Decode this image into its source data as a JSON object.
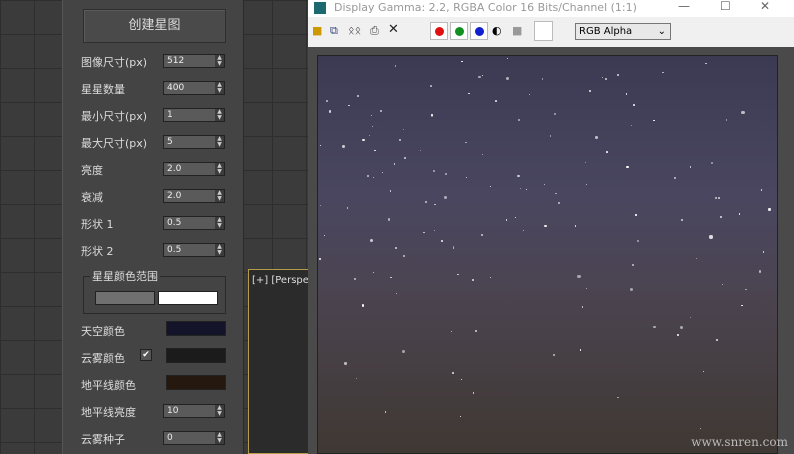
{
  "panel": {
    "create_button": "创建星图",
    "fields": [
      {
        "label": "图像尺寸(px)",
        "value": "512"
      },
      {
        "label": "星星数量",
        "value": "400"
      },
      {
        "label": "最小尺寸(px)",
        "value": "1"
      },
      {
        "label": "最大尺寸(px)",
        "value": "5"
      },
      {
        "label": "亮度",
        "value": "2.0"
      },
      {
        "label": "衰减",
        "value": "2.0"
      },
      {
        "label": "形状 1",
        "value": "0.5"
      },
      {
        "label": "形状 2",
        "value": "0.5"
      }
    ],
    "star_color_range": {
      "title": "星星颜色范围",
      "from": "#707070",
      "to": "#ffffff"
    },
    "colors": [
      {
        "label": "天空颜色",
        "color": "#13132a"
      },
      {
        "label": "云雾颜色",
        "color": "#1b1b1b",
        "checked": true
      },
      {
        "label": "地平线颜色",
        "color": "#24180f"
      }
    ],
    "bottom_fields": [
      {
        "label": "地平线亮度",
        "value": "10"
      },
      {
        "label": "云雾种子",
        "value": "0"
      }
    ]
  },
  "viewport": {
    "label": "[+] [Perspective]"
  },
  "frame_window": {
    "title": "Display Gamma: 2.2, RGBA Color 16 Bits/Channel (1:1)",
    "channel_select": "RGB Alpha",
    "channel_colors": [
      "#e01010",
      "#109020",
      "#1020d0"
    ]
  },
  "watermark": "www.snren.com"
}
